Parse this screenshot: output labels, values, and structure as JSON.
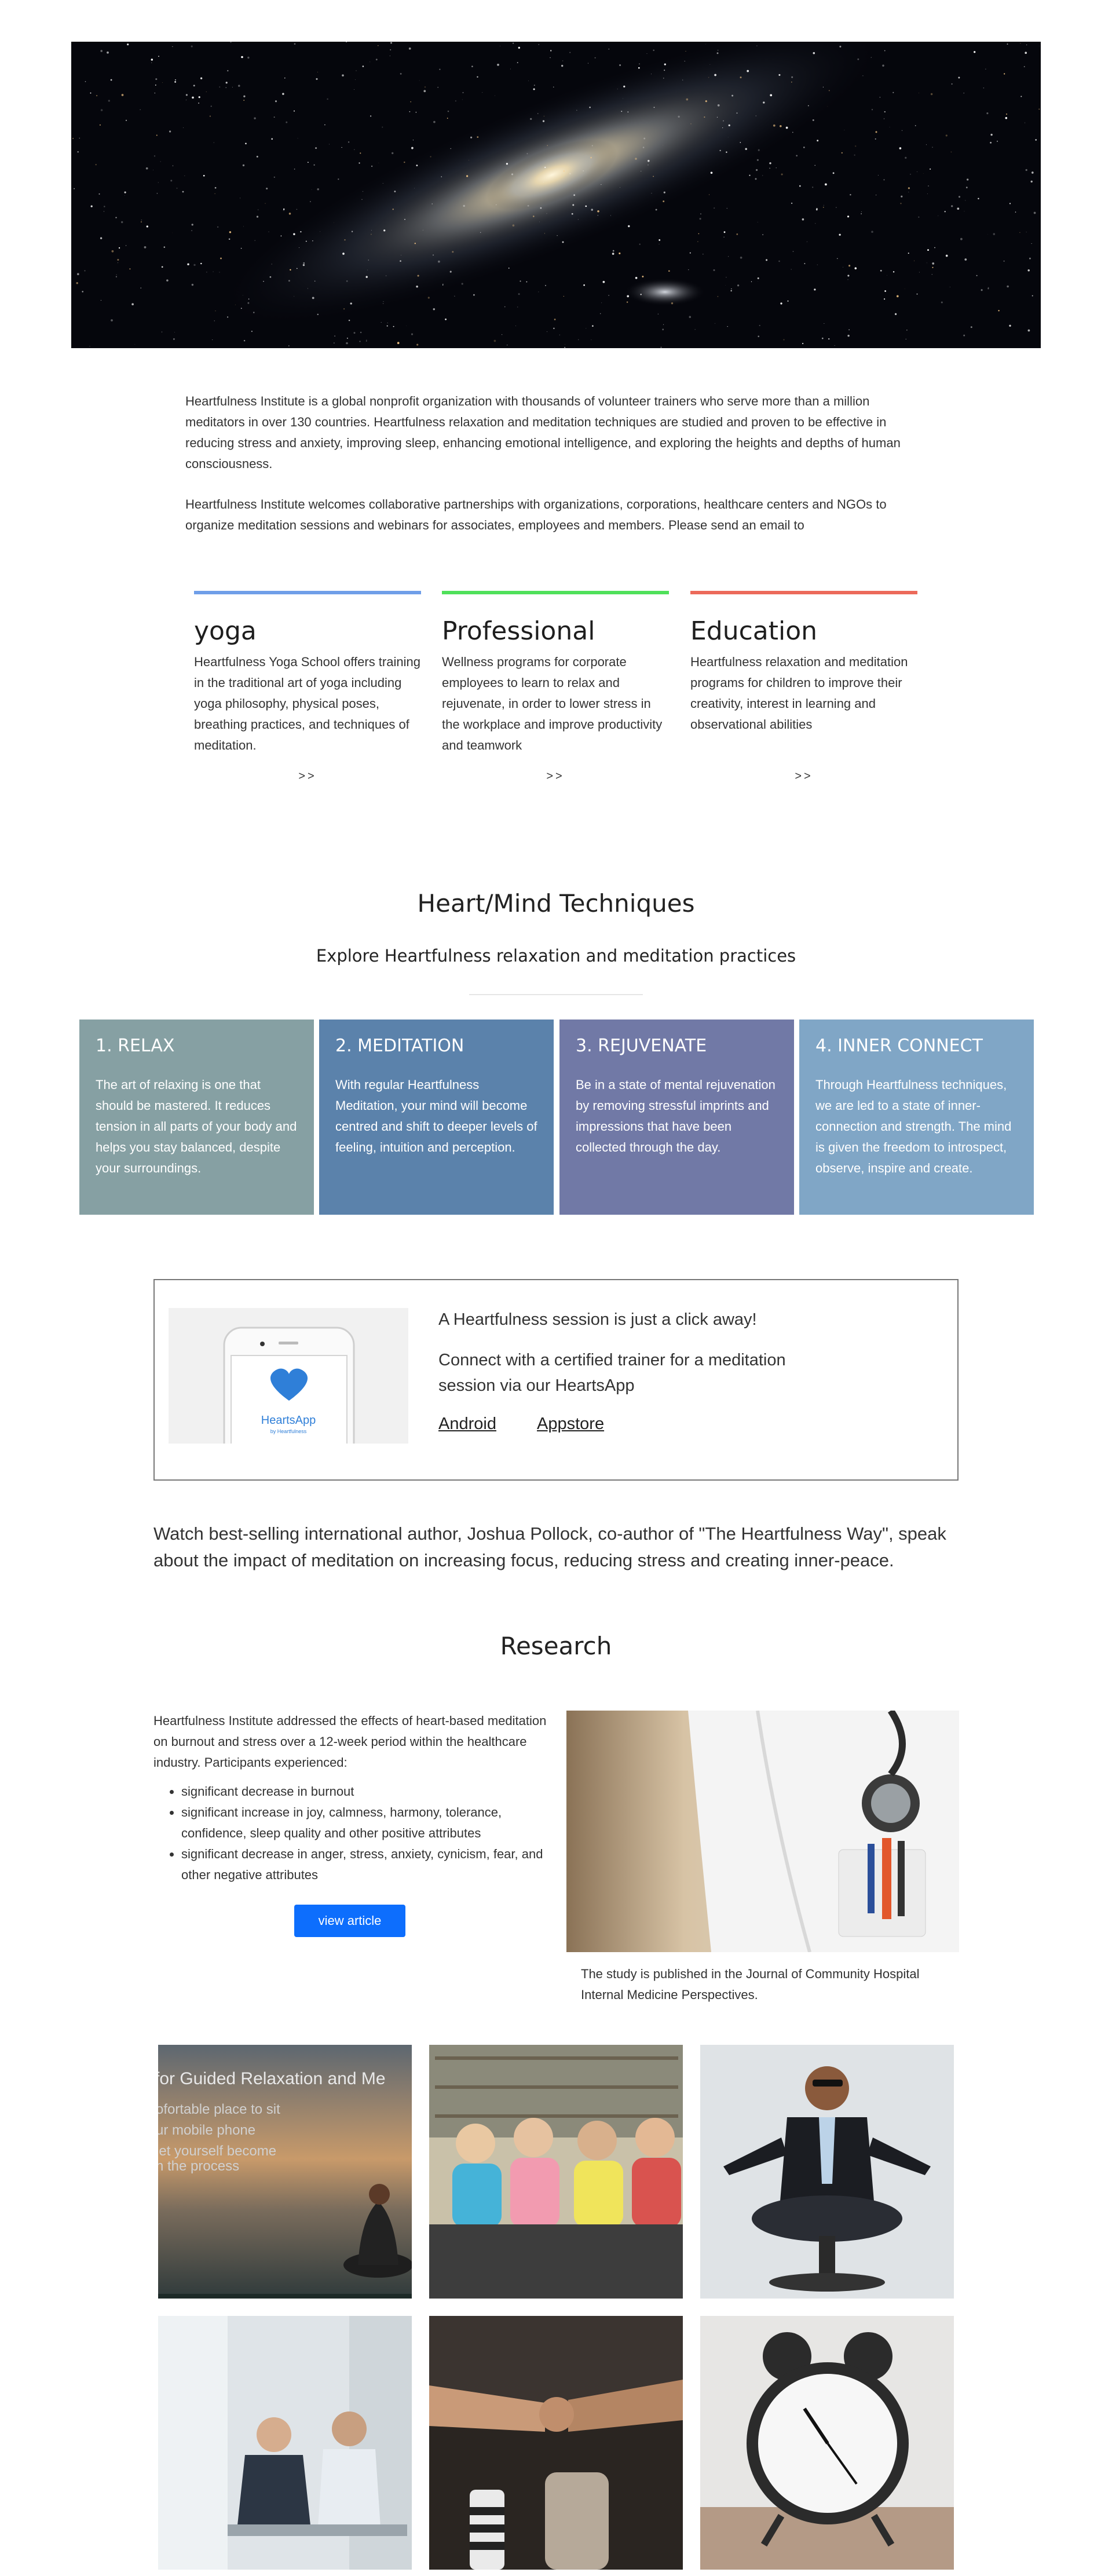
{
  "intro": {
    "p1": "Heartfulness Institute is a global nonprofit organization with thousands of volunteer trainers who serve more than a million meditators in over 130 countries. Heartfulness relaxation and meditation techniques are studied and proven to be effective in reducing stress and anxiety, improving sleep, enhancing emotional intelligence, and exploring the heights and depths of human consciousness.",
    "p2": "Heartfulness Institute welcomes collaborative partnerships with organizations, corporations, healthcare centers and NGOs to organize meditation sessions and webinars for associates, employees and members. Please send an email to"
  },
  "programs": [
    {
      "title": "yoga",
      "text": "Heartfulness Yoga School offers training in the traditional art of yoga including yoga philosophy, physical poses, breathing practices, and techniques of meditation.",
      "more": ">>",
      "color": "#6f9ee8"
    },
    {
      "title": "Professional",
      "text": "Wellness programs for corporate employees to learn to relax and rejuvenate, in order to lower stress in the workplace and improve productivity and teamwork",
      "more": ">>",
      "color": "#4fe05a"
    },
    {
      "title": "Education",
      "text": "Heartfulness relaxation and meditation programs for children to improve their creativity, interest in learning and observational abilities",
      "more": ">>",
      "color": "#ec6a5a"
    }
  ],
  "techniques": {
    "title": "Heart/Mind Techniques",
    "subtitle": "Explore Heartfulness relaxation and meditation practices",
    "items": [
      {
        "title": "1. RELAX",
        "text": "The art of relaxing is one that should be mastered. It reduces tension in all parts of your body and helps you stay balanced, despite your surroundings.",
        "color": "#86a0a3"
      },
      {
        "title": "2. MEDITATION",
        "text": "With regular Heartfulness Meditation, your mind will become centred and shift to deeper levels of feeling, intuition and perception.",
        "color": "#5b82ab"
      },
      {
        "title": "3. REJUVENATE",
        "text": "Be in a state of mental rejuvenation by removing stressful imprints and impressions that have been collected through the day.",
        "color": "#7179a6"
      },
      {
        "title": "4. INNER CONNECT",
        "text": "Through Heartfulness techniques, we are led to a state of inner-connection and strength. The mind is given the freedom to introspect, observe, inspire and create.",
        "color": "#80a6c6"
      }
    ]
  },
  "app": {
    "headline": "A Heartfulness session is just a click away!",
    "body": "Connect with a certified trainer for a meditation session via our HeartsApp",
    "android": "Android",
    "appstore": "Appstore",
    "logo_text": "HeartsApp",
    "logo_sub": "by Heartfulness"
  },
  "watch": "Watch best-selling international author, Joshua Pollock, co-author of \"The Heartfulness Way\", speak about the impact of meditation on increasing focus, reducing stress and creating inner-peace.",
  "research": {
    "title": "Research",
    "intro": "Heartfulness Institute addressed the effects of heart-based meditation on burnout and stress over a 12-week period within the healthcare industry. Participants experienced:",
    "bullets": [
      "significant decrease in burnout",
      "significant increase in joy, calmness, harmony, tolerance, confidence, sleep quality and other positive attributes",
      "significant decrease in anger, stress, anxiety, cynicism, fear, and other negative attributes"
    ],
    "button": "view article",
    "caption": "The study is published in the Journal of Community Hospital Internal Medicine Perspectives."
  },
  "gallery": {
    "video_overlay": [
      "for Guided Relaxation and Me",
      "ofortable place to sit",
      "ur mobile phone",
      "let yourself become",
      "n the process"
    ]
  }
}
